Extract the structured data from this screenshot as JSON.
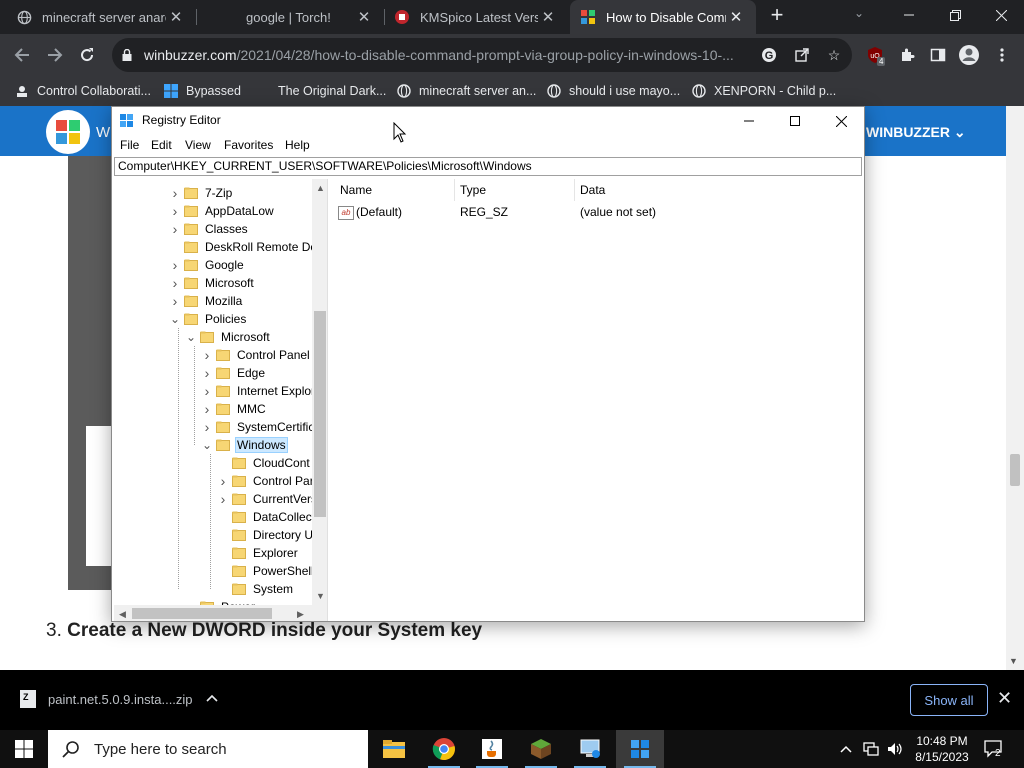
{
  "browser": {
    "tabs": [
      {
        "title": "minecraft server anarc",
        "active": false
      },
      {
        "title": "google | Torch!",
        "active": false
      },
      {
        "title": "KMSpico Latest Version",
        "active": false
      },
      {
        "title": "How to Disable Comm",
        "active": true
      }
    ],
    "url_host": "winbuzzer.com",
    "url_path": "/2021/04/28/how-to-disable-command-prompt-via-group-policy-in-windows-10-...",
    "extension_badge": "4",
    "bookmarks": [
      {
        "label": "Control Collaborati...",
        "icon": "collab-icon"
      },
      {
        "label": "Bypassed",
        "icon": "windows-logo-icon"
      },
      {
        "label": "The Original Dark...",
        "icon": "none"
      },
      {
        "label": "minecraft server an...",
        "icon": "globe-icon"
      },
      {
        "label": "should i use mayo...",
        "icon": "globe-icon"
      },
      {
        "label": "XENPORN - Child p...",
        "icon": "globe-icon"
      }
    ]
  },
  "page": {
    "site_brand_left": "W",
    "site_brand": "WINBUZZER ⌄",
    "heading_number": "3.",
    "heading_text": "Create a New DWORD inside your System key"
  },
  "regedit": {
    "title": "Registry Editor",
    "menus": [
      "File",
      "Edit",
      "View",
      "Favorites",
      "Help"
    ],
    "address": "Computer\\HKEY_CURRENT_USER\\SOFTWARE\\Policies\\Microsoft\\Windows",
    "tree": [
      {
        "label": "7-Zip",
        "level": 0,
        "expander": "›"
      },
      {
        "label": "AppDataLow",
        "level": 0,
        "expander": "›"
      },
      {
        "label": "Classes",
        "level": 0,
        "expander": "›"
      },
      {
        "label": "DeskRoll Remote De",
        "level": 0,
        "expander": ""
      },
      {
        "label": "Google",
        "level": 0,
        "expander": "›"
      },
      {
        "label": "Microsoft",
        "level": 0,
        "expander": "›"
      },
      {
        "label": "Mozilla",
        "level": 0,
        "expander": "›"
      },
      {
        "label": "Policies",
        "level": 0,
        "expander": "⌄"
      },
      {
        "label": "Microsoft",
        "level": 1,
        "expander": "⌄"
      },
      {
        "label": "Control Panel",
        "level": 2,
        "expander": "›"
      },
      {
        "label": "Edge",
        "level": 2,
        "expander": "›"
      },
      {
        "label": "Internet Explor",
        "level": 2,
        "expander": "›"
      },
      {
        "label": "MMC",
        "level": 2,
        "expander": "›"
      },
      {
        "label": "SystemCertific",
        "level": 2,
        "expander": "›"
      },
      {
        "label": "Windows",
        "level": 2,
        "expander": "⌄",
        "selected": true
      },
      {
        "label": "CloudCont",
        "level": 3,
        "expander": ""
      },
      {
        "label": "Control Par",
        "level": 3,
        "expander": "›"
      },
      {
        "label": "CurrentVers",
        "level": 3,
        "expander": "›"
      },
      {
        "label": "DataCollect",
        "level": 3,
        "expander": ""
      },
      {
        "label": "Directory U",
        "level": 3,
        "expander": ""
      },
      {
        "label": "Explorer",
        "level": 3,
        "expander": ""
      },
      {
        "label": "PowerShell",
        "level": 3,
        "expander": ""
      },
      {
        "label": "System",
        "level": 3,
        "expander": ""
      },
      {
        "label": "Power",
        "level": 1,
        "expander": "›"
      }
    ],
    "columns": [
      "Name",
      "Type",
      "Data"
    ],
    "values": [
      {
        "name": "(Default)",
        "type": "REG_SZ",
        "data": "(value not set)"
      }
    ]
  },
  "downloads": {
    "file": "paint.net.5.0.9.insta....zip",
    "show_all": "Show all"
  },
  "taskbar": {
    "search_placeholder": "Type here to search",
    "time": "10:48 PM",
    "date": "8/15/2023",
    "notification_count": "2"
  },
  "colors": {
    "chrome_dark": "#202124",
    "chrome_toolbar": "#35363a",
    "site_blue": "#1a73c8",
    "selection": "#cce8ff",
    "link_blue": "#8ab4f8"
  }
}
